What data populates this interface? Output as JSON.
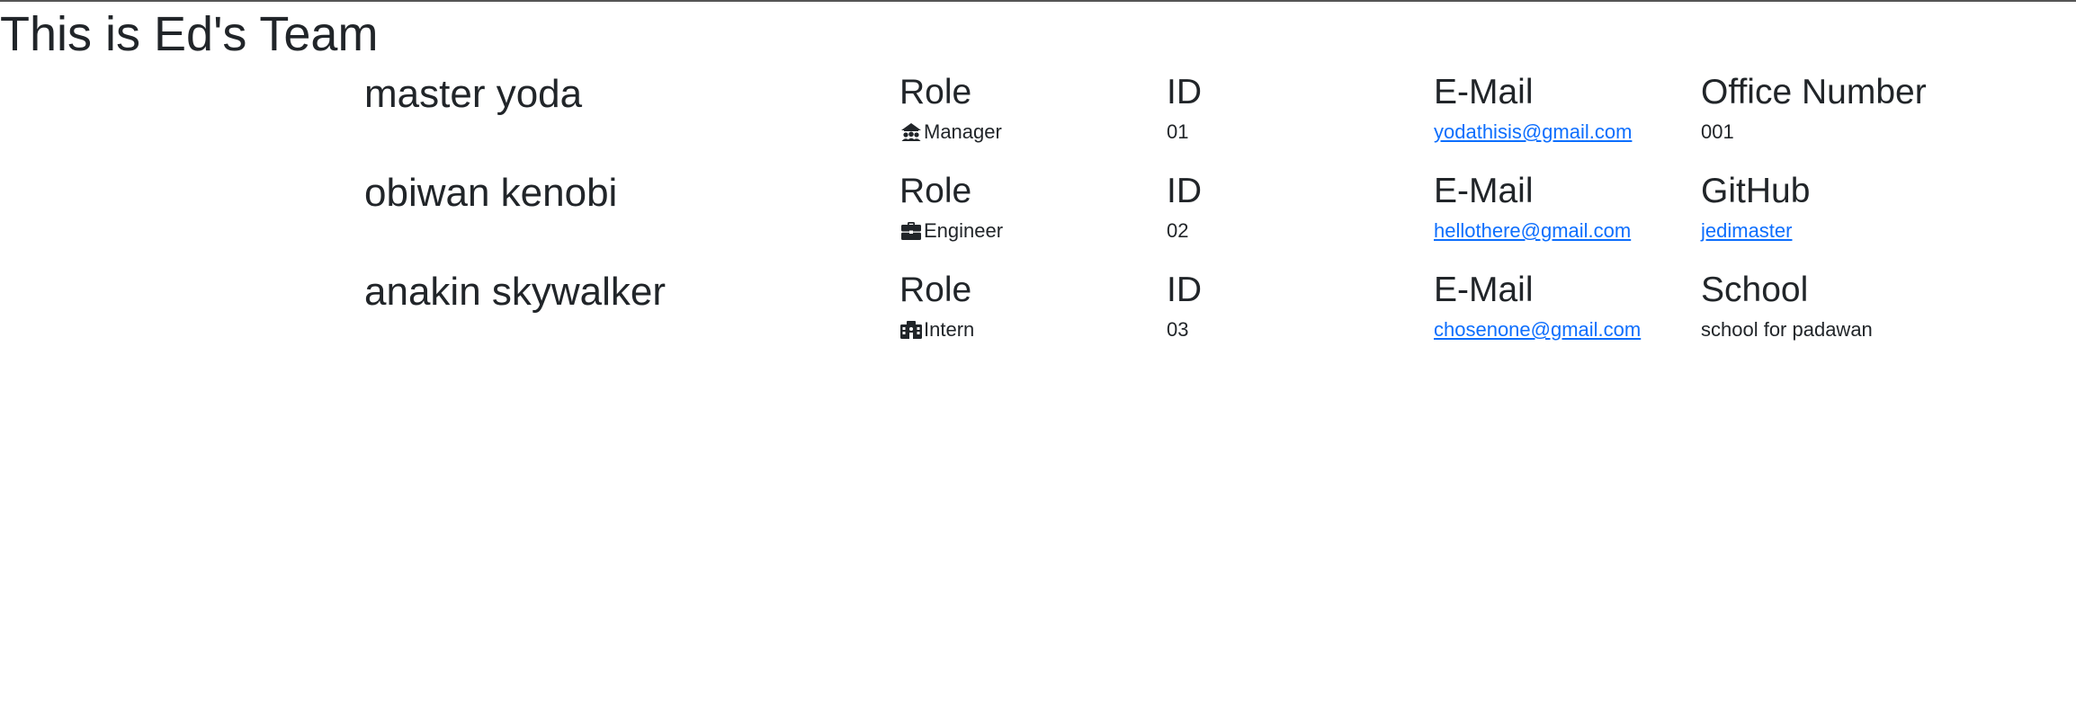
{
  "page": {
    "title": "This is Ed's Team"
  },
  "labels": {
    "role": "Role",
    "id": "ID",
    "email": "E-Mail"
  },
  "members": [
    {
      "name": "master yoda",
      "role": "Manager",
      "role_icon": "manager-icon",
      "id": "01",
      "email": "yodathisis@gmail.com",
      "extra_label": "Office Number",
      "extra_value": "001",
      "extra_is_link": false
    },
    {
      "name": "obiwan kenobi",
      "role": "Engineer",
      "role_icon": "briefcase-icon",
      "id": "02",
      "email": "hellothere@gmail.com",
      "extra_label": "GitHub",
      "extra_value": "jedimaster",
      "extra_is_link": true
    },
    {
      "name": "anakin skywalker",
      "role": "Intern",
      "role_icon": "school-icon",
      "id": "03",
      "email": "chosenone@gmail.com",
      "extra_label": "School",
      "extra_value": "school for padawan",
      "extra_is_link": false
    }
  ],
  "colors": {
    "text": "#212529",
    "link": "#0d6efd"
  }
}
